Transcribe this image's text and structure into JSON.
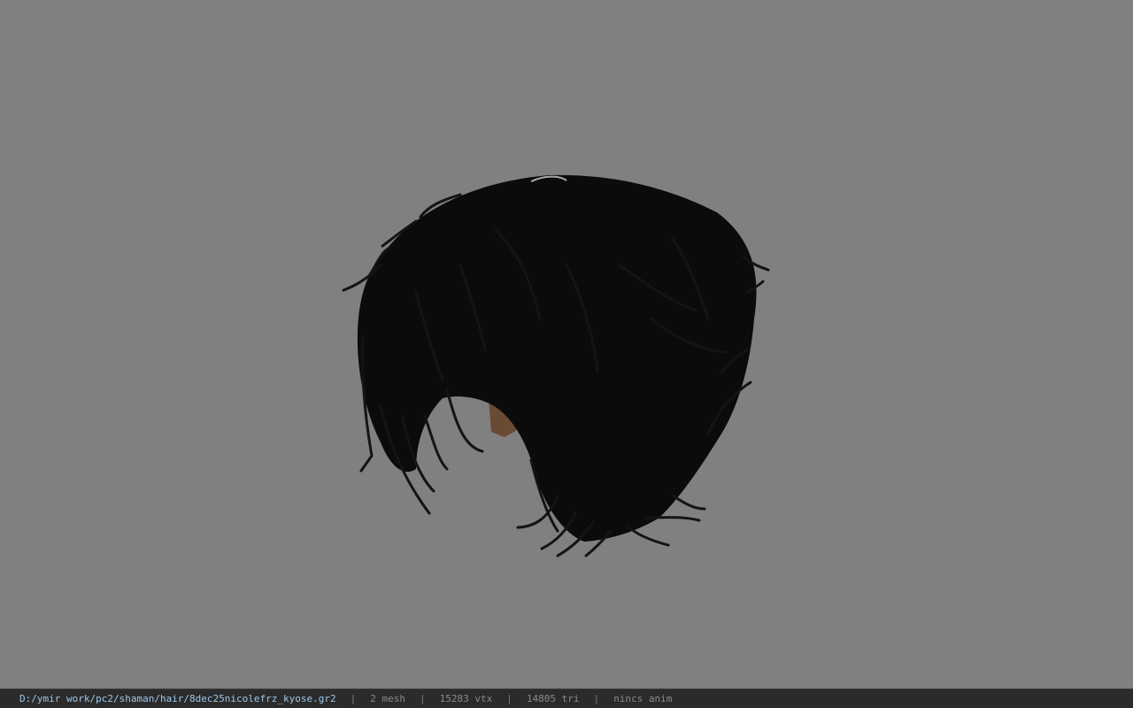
{
  "viewport": {
    "background_color": "#808080",
    "model_icon": "hair-mesh-model"
  },
  "statusbar": {
    "file_path": "D:/ymir work/pc2/shaman/hair/8dec25nicolefrz_kyose.gr2",
    "separator": "|",
    "mesh_count": "2 mesh",
    "vertex_count": "15283 vtx",
    "triangle_count": "14805 tri",
    "anim_status": "nincs anim",
    "path_color": "#9fc7e8",
    "text_color": "#8a8a8a",
    "background_color": "#2b2b2b"
  }
}
